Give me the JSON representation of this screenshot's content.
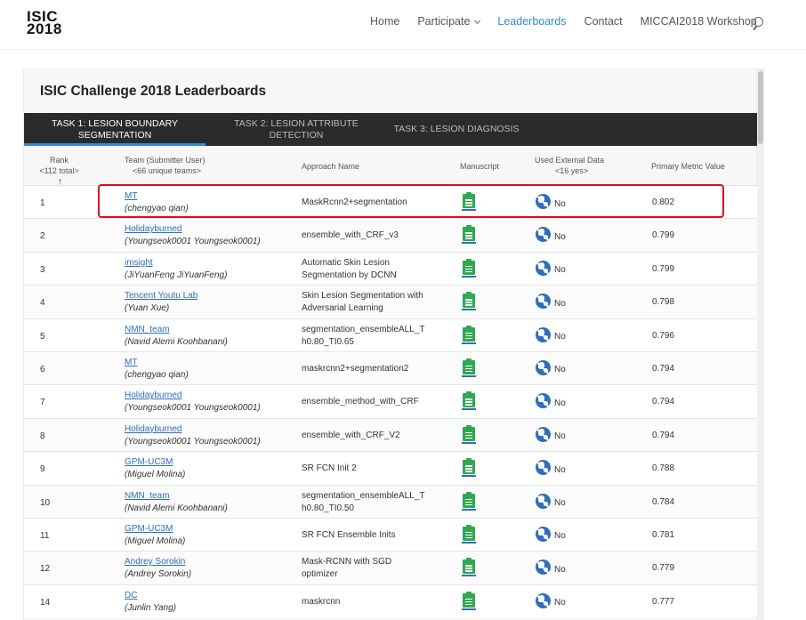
{
  "header": {
    "logo_line1": "ISIC",
    "logo_line2": "2018",
    "nav": {
      "home": "Home",
      "participate": "Participate",
      "leaderboards": "Leaderboards",
      "contact": "Contact",
      "workshop": "MICCAI2018 Workshop"
    },
    "accent_color": "#2e8ecf"
  },
  "panel": {
    "title": "ISIC Challenge 2018 Leaderboards",
    "tabs": [
      {
        "line1": "Task 1: Lesion Boundary",
        "line2": "Segmentation"
      },
      {
        "line1": "Task 2: Lesion Attribute",
        "line2": "Detection"
      },
      {
        "line1": "Task 3: Lesion Diagnosis",
        "line2": ""
      }
    ]
  },
  "table": {
    "headers": {
      "rank": "Rank",
      "rank_sub": "<112 total>",
      "team": "Team (Submitter User)",
      "team_sub": "<66 unique teams>",
      "approach": "Approach Name",
      "manuscript": "Manuscript",
      "external": "Used External Data",
      "external_sub": "<16 yes>",
      "metric": "Primary Metric Value"
    },
    "rows": [
      {
        "rank": "1",
        "team": "MT",
        "user": "(chengyao qian)",
        "approach1": "MaskRcnn2+segmentation",
        "approach2": "",
        "external": "No",
        "metric": "0.802"
      },
      {
        "rank": "2",
        "team": "Holidayburned",
        "user": "(Youngseok0001 Youngseok0001)",
        "approach1": "ensemble_with_CRF_v3",
        "approach2": "",
        "external": "No",
        "metric": "0.799"
      },
      {
        "rank": "3",
        "team": "imsight",
        "user": "(JiYuanFeng JiYuanFeng)",
        "approach1": "Automatic Skin Lesion",
        "approach2": "Segmentation by DCNN",
        "external": "No",
        "metric": "0.799"
      },
      {
        "rank": "4",
        "team": "Tencent Youtu Lab",
        "user": "(Yuan Xue)",
        "approach1": "Skin Lesion Segmentation with",
        "approach2": "Adversarial Learning",
        "external": "No",
        "metric": "0.798"
      },
      {
        "rank": "5",
        "team": "NMN_team",
        "user": "(Navid Alemi Koohbanani)",
        "approach1": "segmentation_ensembleALL_T",
        "approach2": "h0.80_TI0.65",
        "external": "No",
        "metric": "0.796"
      },
      {
        "rank": "6",
        "team": "MT",
        "user": "(chengyao qian)",
        "approach1": "maskrcnn2+segmentation2",
        "approach2": "",
        "external": "No",
        "metric": "0.794"
      },
      {
        "rank": "7",
        "team": "Holidayburned",
        "user": "(Youngseok0001 Youngseok0001)",
        "approach1": "ensemble_method_with_CRF",
        "approach2": "",
        "external": "No",
        "metric": "0.794"
      },
      {
        "rank": "8",
        "team": "Holidayburned",
        "user": "(Youngseok0001 Youngseok0001)",
        "approach1": "ensemble_with_CRF_V2",
        "approach2": "",
        "external": "No",
        "metric": "0.794"
      },
      {
        "rank": "9",
        "team": "GPM-UC3M",
        "user": "(Miguel Molina)",
        "approach1": "SR FCN Init 2",
        "approach2": "",
        "external": "No",
        "metric": "0.788"
      },
      {
        "rank": "10",
        "team": "NMN_team",
        "user": "(Navid Alemi Koohbanani)",
        "approach1": "segmentation_ensembleALL_T",
        "approach2": "h0.80_TI0.50",
        "external": "No",
        "metric": "0.784"
      },
      {
        "rank": "11",
        "team": "GPM-UC3M",
        "user": "(Miguel Molina)",
        "approach1": "SR FCN Ensemble Inits",
        "approach2": "",
        "external": "No",
        "metric": "0.781"
      },
      {
        "rank": "12",
        "team": "Andrey Sorokin",
        "user": "(Andrey Sorokin)",
        "approach1": "Mask-RCNN with SGD",
        "approach2": "optimizer",
        "external": "No",
        "metric": "0.779"
      },
      {
        "rank": "14",
        "team": "DC",
        "user": "(Junlin Yang)",
        "approach1": "maskrcnn",
        "approach2": "",
        "external": "No",
        "metric": "0.777"
      }
    ]
  },
  "icons": {
    "manuscript": "document-icon",
    "external": "globe-no-icon",
    "sort": "arrow-up-icon"
  }
}
